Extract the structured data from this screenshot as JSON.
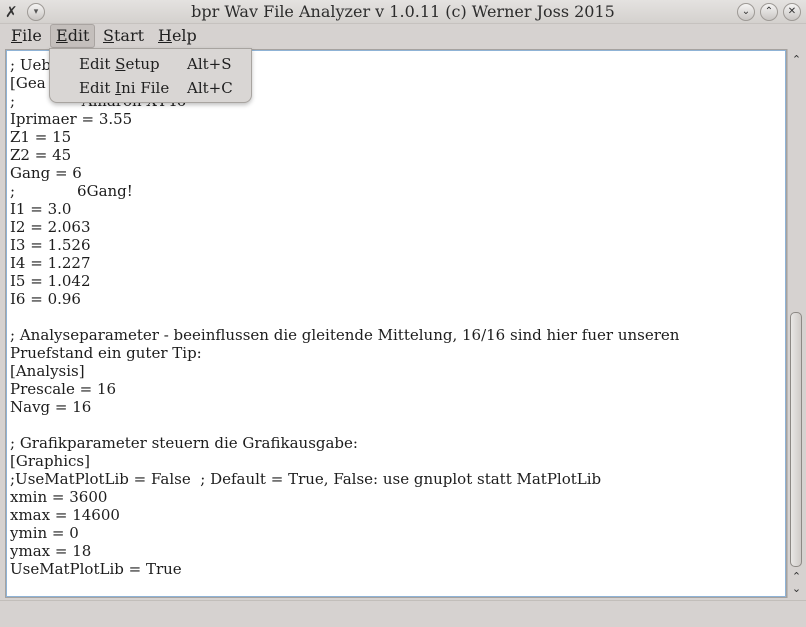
{
  "window": {
    "title": "bpr Wav File Analyzer v 1.0.11 (c) Werner Joss 2015",
    "icons": {
      "app": "tools-icon",
      "menu": "window-menu-icon",
      "minimize": "chevron-down-icon",
      "maximize": "chevron-up-icon",
      "close": "close-icon"
    }
  },
  "menubar": {
    "file": {
      "pre": "",
      "u": "F",
      "post": "ile"
    },
    "edit": {
      "pre": "",
      "u": "E",
      "post": "dit"
    },
    "start": {
      "pre": "",
      "u": "S",
      "post": "tart"
    },
    "help": {
      "pre": "",
      "u": "H",
      "post": "elp"
    }
  },
  "edit_menu": {
    "setup": {
      "pre": "Edit ",
      "u": "S",
      "post": "etup",
      "shortcut": "Alt+S"
    },
    "ini": {
      "pre": "Edit ",
      "u": "I",
      "post": "ni File",
      "shortcut": "Alt+C"
    }
  },
  "editor": {
    "lines": [
      "; Ueb                            n:",
      "[Gea",
      ";              Amaron XT46",
      "Iprimaer = 3.55",
      "Z1 = 15",
      "Z2 = 45",
      "Gang = 6",
      ";             6Gang!",
      "I1 = 3.0",
      "I2 = 2.063",
      "I3 = 1.526",
      "I4 = 1.227",
      "I5 = 1.042",
      "I6 = 0.96",
      "",
      "; Analyseparameter - beeinflussen die gleitende Mittelung, 16/16 sind hier fuer unseren",
      "Pruefstand ein guter Tip:",
      "[Analysis]",
      "Prescale = 16",
      "Navg = 16",
      "",
      "; Grafikparameter steuern die Grafikausgabe:",
      "[Graphics]",
      ";UseMatPlotLib = False  ; Default = True, False: use gnuplot statt MatPlotLib",
      "xmin = 3600",
      "xmax = 14600",
      "ymin = 0",
      "ymax = 18",
      "UseMatPlotLib = True"
    ]
  },
  "scrollbar": {
    "position_fraction": 0.45,
    "icons": {
      "up": "arrow-up-icon",
      "down": "arrow-down-icon"
    }
  }
}
